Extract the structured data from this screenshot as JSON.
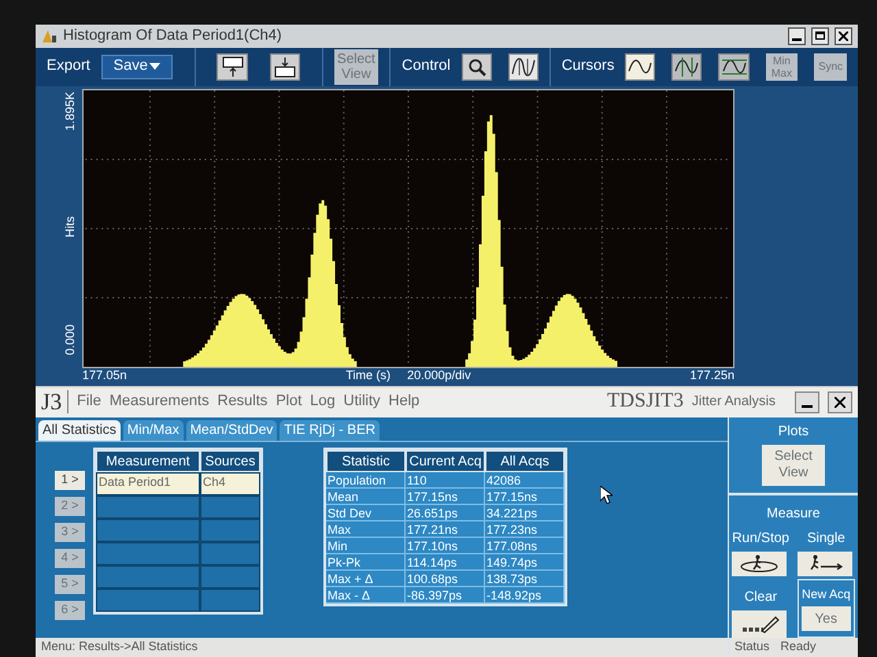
{
  "window": {
    "title": "Histogram Of Data Period1(Ch4)"
  },
  "toolbar": {
    "export_label": "Export",
    "save_value": "Save",
    "select_view": {
      "label": "Select View",
      "disabled": true
    },
    "control_label": "Control",
    "cursors_label": "Cursors",
    "min_max": {
      "label": "Min Max",
      "disabled": true
    },
    "sync": {
      "label": "Sync",
      "disabled": true
    }
  },
  "plot": {
    "y_max": "1.895K",
    "y_min": "0.000",
    "ylabel": "Hits",
    "x_min": "177.05n",
    "xlabel": "Time (s)",
    "scale": "20.000p/div",
    "x_max": "177.25n"
  },
  "analysis": {
    "logo": "J3",
    "menu": [
      "File",
      "Measurements",
      "Results",
      "Plot",
      "Log",
      "Utility",
      "Help"
    ],
    "brand": "TDSJIT3",
    "subtitle": "Jitter Analysis",
    "tabs": [
      {
        "label": "All Statistics",
        "selected": true
      },
      {
        "label": "Min/Max",
        "selected": false
      },
      {
        "label": "Mean/StdDev",
        "selected": false
      },
      {
        "label": "TIE RjDj - BER",
        "selected": false
      }
    ],
    "measurements": {
      "columns": [
        "Measurement",
        "Sources"
      ],
      "rows": [
        {
          "button": "1 >",
          "disabled": false,
          "selected": true,
          "measurement": "Data Period1",
          "source": "Ch4"
        },
        {
          "button": "2 >",
          "disabled": true,
          "selected": false
        },
        {
          "button": "3 >",
          "disabled": true,
          "selected": false
        },
        {
          "button": "4 >",
          "disabled": true,
          "selected": false
        },
        {
          "button": "5 >",
          "disabled": true,
          "selected": false
        },
        {
          "button": "6 >",
          "disabled": true,
          "selected": false
        }
      ]
    },
    "statistics": {
      "columns": [
        "Statistic",
        "Current Acq",
        "All Acqs"
      ],
      "rows": [
        [
          "Population",
          "110",
          "42086"
        ],
        [
          "Mean",
          "177.15ns",
          "177.15ns"
        ],
        [
          "Std Dev",
          "26.651ps",
          "34.221ps"
        ],
        [
          "Max",
          "177.21ns",
          "177.23ns"
        ],
        [
          "Min",
          "177.10ns",
          "177.08ns"
        ],
        [
          "Pk-Pk",
          "114.14ps",
          "149.74ps"
        ],
        [
          "Max + Δ",
          "100.68ps",
          "138.73ps"
        ],
        [
          "Max - Δ",
          "-86.397ps",
          "-148.92ps"
        ]
      ]
    },
    "plots_panel": {
      "title": "Plots",
      "button": {
        "label": "Select View",
        "disabled": true
      }
    },
    "measure_panel": {
      "title": "Measure",
      "run_stop": "Run/Stop",
      "single": "Single",
      "clear": "Clear",
      "new_acq": "New Acq",
      "new_acq_button": {
        "label": "Yes",
        "disabled": true
      }
    },
    "status_bar": {
      "menu_path": "Menu: Results->All Statistics",
      "status_label": "Status",
      "status_value": "Ready"
    }
  }
}
